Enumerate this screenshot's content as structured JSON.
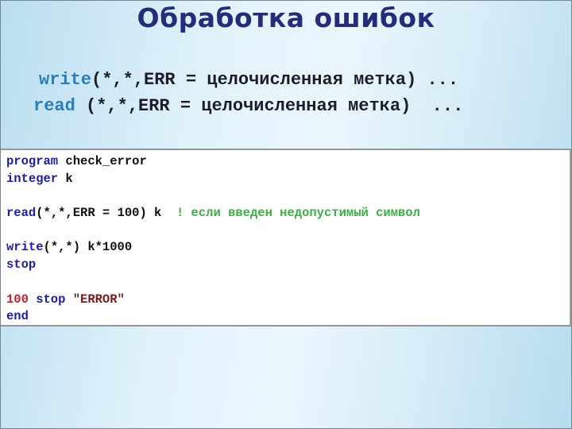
{
  "slide": {
    "title": "Обработка ошибок",
    "syntax_lines": [
      {
        "keyword": "write",
        "rest": "(*,*,ERR = целочисленная метка) ..."
      },
      {
        "keyword": "read",
        "rest": " (*,*,ERR = целочисленная метка)  ..."
      }
    ]
  },
  "code": {
    "lines": [
      {
        "kw": "program",
        "text": " check_error"
      },
      {
        "kw": "integer",
        "text": " k"
      },
      {
        "kw": "",
        "text": ""
      },
      {
        "kw": "read",
        "text": "(*,*,ERR = 100) k  ",
        "comment": "! если введен недопустимый символ"
      },
      {
        "kw": "",
        "text": ""
      },
      {
        "kw": "write",
        "text": "(*,*) k*1000"
      },
      {
        "kw": "stop",
        "text": ""
      },
      {
        "kw": "",
        "text": ""
      },
      {
        "label": "100",
        "kw": " stop",
        "string": " \"ERROR\""
      },
      {
        "kw": "end",
        "text": ""
      }
    ]
  },
  "colors": {
    "title": "#262c7c",
    "syntax_keyword": "#2d7db8",
    "code_keyword": "#1d1dae",
    "comment": "#3cb043",
    "label": "#c0202a",
    "string": "#7a1a1a"
  }
}
